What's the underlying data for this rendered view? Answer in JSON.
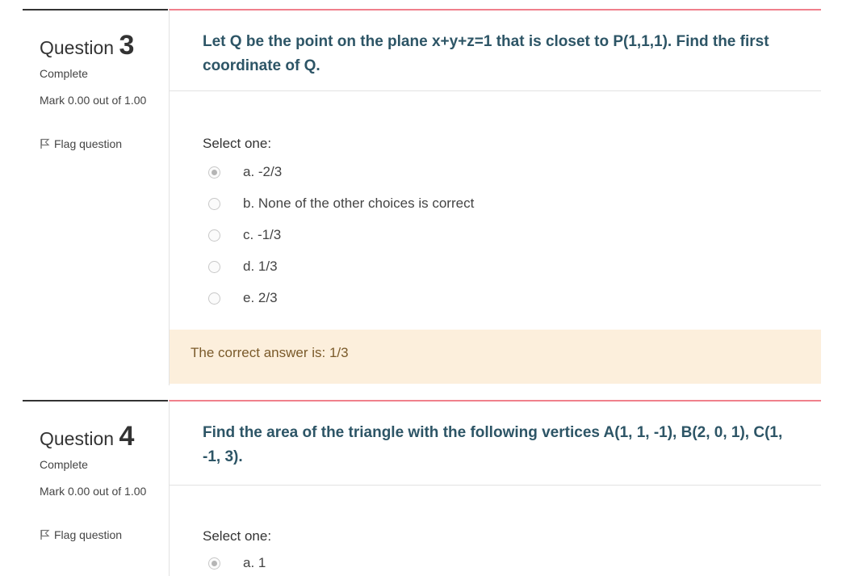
{
  "questions": [
    {
      "label": "Question",
      "number": "3",
      "state": "Complete",
      "mark": "Mark 0.00 out of 1.00",
      "flag": "Flag question",
      "text": "Let Q be the point on the plane x+y+z=1 that is closet to P(1,1,1). Find the first coordinate of Q.",
      "prompt": "Select one:",
      "options": [
        {
          "label": "a. -2/3",
          "checked": true
        },
        {
          "label": "b. None of the other choices is correct",
          "checked": false
        },
        {
          "label": "c. -1/3",
          "checked": false
        },
        {
          "label": "d. 1/3",
          "checked": false
        },
        {
          "label": "e. 2/3",
          "checked": false
        }
      ],
      "feedback": "The correct answer is: 1/3"
    },
    {
      "label": "Question",
      "number": "4",
      "state": "Complete",
      "mark": "Mark 0.00 out of 1.00",
      "flag": "Flag question",
      "text": "Find the area of the triangle with the following vertices A(1, 1, -1), B(2, 0, 1), C(1, -1, 3).",
      "prompt": "Select one:",
      "options": [
        {
          "label": "a. 1",
          "checked": true
        }
      ]
    }
  ],
  "colors": {
    "accent_border": "#f0808c",
    "question_text": "#2d5566",
    "feedback_bg": "#fcefdc"
  }
}
